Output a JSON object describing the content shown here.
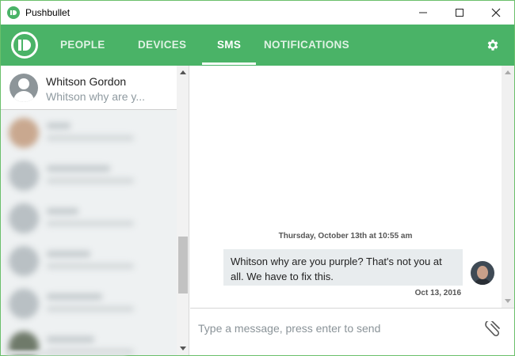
{
  "window": {
    "title": "Pushbullet",
    "icon": "pushbullet-logo-icon",
    "controls": [
      "minimize-icon",
      "maximize-icon",
      "close-icon"
    ]
  },
  "colors": {
    "brand": "#4ab367",
    "sidebar_bg": "#eef1f2",
    "bubble_bg": "#e8ecee"
  },
  "nav": {
    "tabs": [
      {
        "label": "PEOPLE"
      },
      {
        "label": "DEVICES"
      },
      {
        "label": "SMS",
        "active": true
      },
      {
        "label": "NOTIFICATIONS"
      }
    ],
    "settings_icon": "gear-icon"
  },
  "sidebar": {
    "active_contact": {
      "name": "Whitson Gordon",
      "preview": "Whitson why are y..."
    }
  },
  "chat": {
    "date_header": "Thursday, October 13th at 10:55 am",
    "message": {
      "text": "Whitson why are you purple? That's not you at all. We have to fix this.",
      "date": "Oct 13, 2016"
    }
  },
  "composer": {
    "placeholder": "Type a message, press enter to send",
    "value": "",
    "attach_icon": "paperclip-icon"
  }
}
